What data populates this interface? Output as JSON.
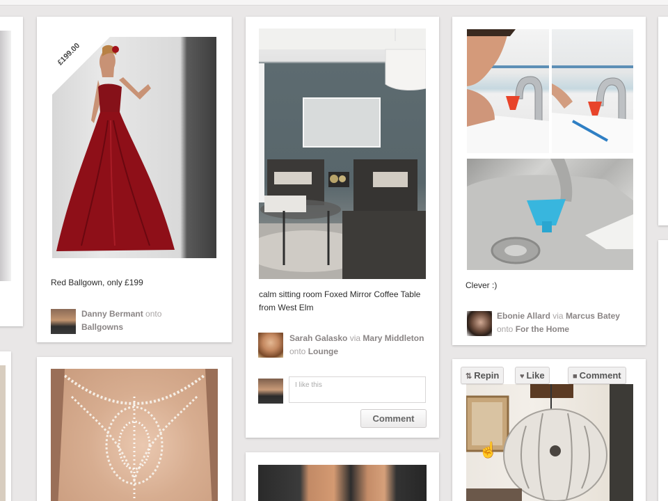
{
  "pins": [
    {
      "price_badge": "£199.00",
      "description": "Red Ballgown, only £199",
      "pinner": "Danny Bermant",
      "onto_word": "onto",
      "board": "Ballgowns"
    },
    {
      "description": "calm sitting room Foxed Mirror Coffee Table from West Elm",
      "pinner": "Sarah Galasko",
      "via_word": "via",
      "via_user": "Mary Middleton",
      "onto_word": "onto",
      "board": "Lounge",
      "comment_placeholder": "I like this",
      "comment_button": "Comment"
    },
    {
      "description": "Clever :)",
      "pinner": "Ebonie Allard",
      "via_word": "via",
      "via_user": "Marcus Batey",
      "onto_word": "onto",
      "board": "For the Home"
    }
  ],
  "hover_actions": {
    "repin": "Repin",
    "like": "Like",
    "comment": "Comment"
  },
  "icons": [
    "repin-icon",
    "heart-icon",
    "comment-icon",
    "hand-cursor-icon"
  ],
  "colors": {
    "page_bg": "#e9e7e7",
    "card_bg": "#ffffff",
    "attribution_link": "#8a8585",
    "dress_red": "#8e0f18"
  }
}
